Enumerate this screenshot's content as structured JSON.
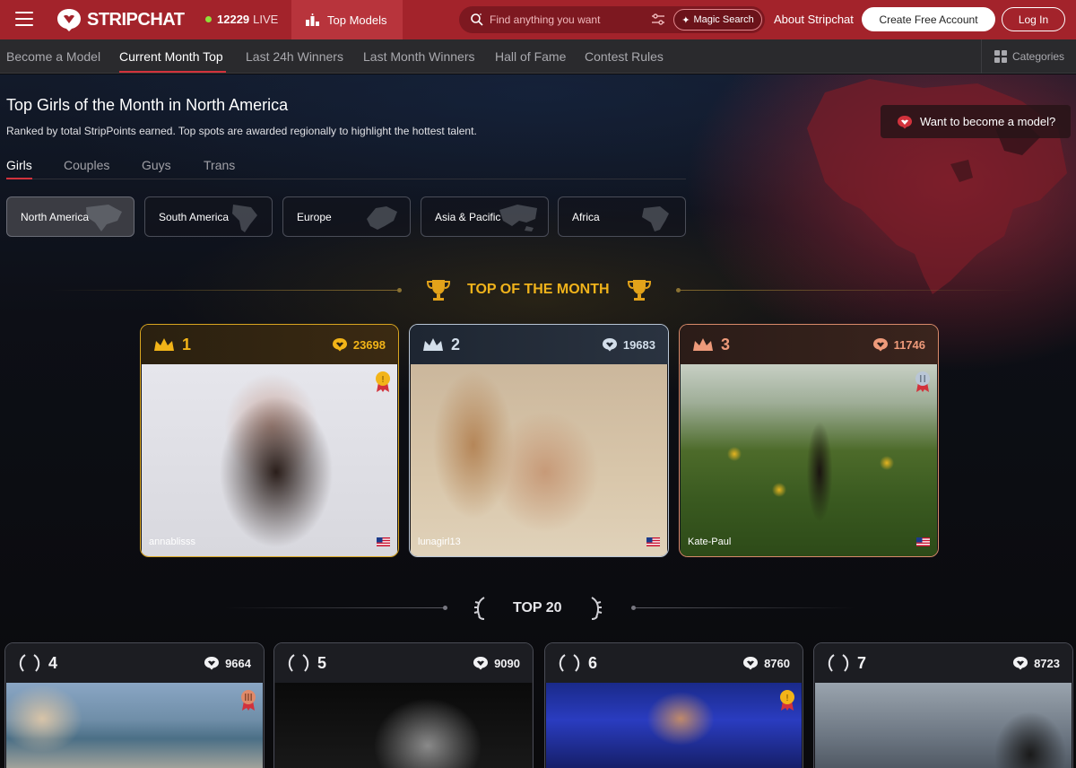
{
  "header": {
    "brand": "STRIPCHAT",
    "live_count": "12229",
    "live_label": "LIVE",
    "top_models": "Top Models",
    "search_placeholder": "Find anything you want",
    "magic_search": "Magic Search",
    "about": "About Stripchat",
    "create_account": "Create Free Account",
    "login": "Log In"
  },
  "subnav": {
    "items": [
      "Become a Model",
      "Current Month Top",
      "Last 24h Winners",
      "Last Month Winners",
      "Hall of Fame",
      "Contest Rules"
    ],
    "active": "Current Month Top",
    "categories": "Categories"
  },
  "page": {
    "title": "Top Girls of the Month in North America",
    "subtitle": "Ranked by total StripPoints earned. Top spots are awarded regionally to highlight the hottest talent.",
    "become_model": "Want to become a model?"
  },
  "gender_tabs": [
    "Girls",
    "Couples",
    "Guys",
    "Trans"
  ],
  "regions": [
    "North America",
    "South America",
    "Europe",
    "Asia & Pacific",
    "Africa"
  ],
  "sections": {
    "top_month": "TOP OF THE MONTH",
    "top20": "TOP 20"
  },
  "podium": [
    {
      "rank": "1",
      "points": "23698",
      "username": "annablisss",
      "tier": "gold"
    },
    {
      "rank": "2",
      "points": "19683",
      "username": "lunagirl13",
      "tier": "silver"
    },
    {
      "rank": "3",
      "points": "11746",
      "username": "Kate-Paul",
      "tier": "bronze"
    }
  ],
  "top20": [
    {
      "rank": "4",
      "points": "9664"
    },
    {
      "rank": "5",
      "points": "9090"
    },
    {
      "rank": "6",
      "points": "8760"
    },
    {
      "rank": "7",
      "points": "8723"
    }
  ],
  "colors": {
    "brand_red": "#a3232b",
    "gold": "#f2b418",
    "silver": "#d3deea",
    "bronze": "#ee9a7a",
    "accent_underline": "#d2323c"
  }
}
